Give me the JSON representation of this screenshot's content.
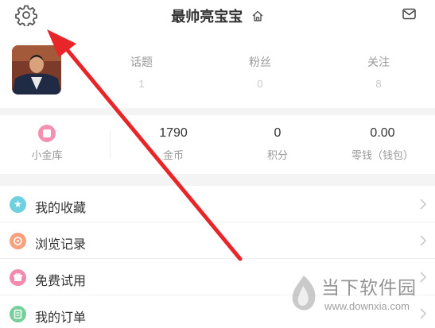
{
  "header": {
    "title": "最帅亮宝宝",
    "gear_icon": "gear-icon",
    "home_icon": "home-icon",
    "mail_icon": "mail-icon"
  },
  "profile": {
    "stats": [
      {
        "label": "话题",
        "value": "1"
      },
      {
        "label": "粉丝",
        "value": "0"
      },
      {
        "label": "关注",
        "value": "8"
      }
    ]
  },
  "wallet": {
    "vault_label": "小金库",
    "items": [
      {
        "value": "1790",
        "label": "金币"
      },
      {
        "value": "0",
        "label": "积分"
      },
      {
        "value": "0.00",
        "label": "零钱（钱包）"
      }
    ]
  },
  "menu": {
    "items": [
      {
        "label": "我的收藏",
        "icon": "star-icon",
        "color": "#6fd0e0"
      },
      {
        "label": "浏览记录",
        "icon": "history-icon",
        "color": "#f7a27c"
      },
      {
        "label": "免费试用",
        "icon": "gift-icon",
        "color": "#f48aab"
      },
      {
        "label": "我的订单",
        "icon": "order-icon",
        "color": "#77cf9b"
      }
    ]
  },
  "watermark": {
    "name": "当下软件园",
    "url": "www.downxia.com"
  },
  "colors": {
    "annotation_arrow": "#e8262a",
    "section_gap": "#f4f4f4"
  }
}
